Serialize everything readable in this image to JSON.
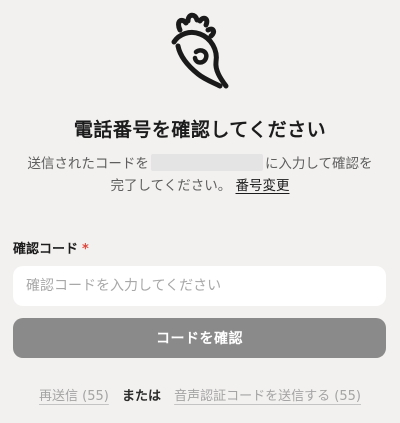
{
  "header": {
    "logo_icon": "hand-gesture-logo-icon",
    "title": "電話番号を確認してください"
  },
  "description": {
    "before_phone": "送信されたコードを",
    "after_phone": "に入力して確認を完了してください。",
    "change_link": "番号変更"
  },
  "form": {
    "code_label": "確認コード",
    "required_mark": "*",
    "code_value": "",
    "code_placeholder": "確認コードを入力してください",
    "confirm_label": "コードを確認"
  },
  "footer": {
    "resend_label": "再送信 (55)",
    "or_text": "または",
    "voice_label": "音声認証コードを送信する (55)"
  },
  "colors": {
    "background": "#f2f1ef",
    "button": "#8a8a8a",
    "required": "#e0473c"
  }
}
